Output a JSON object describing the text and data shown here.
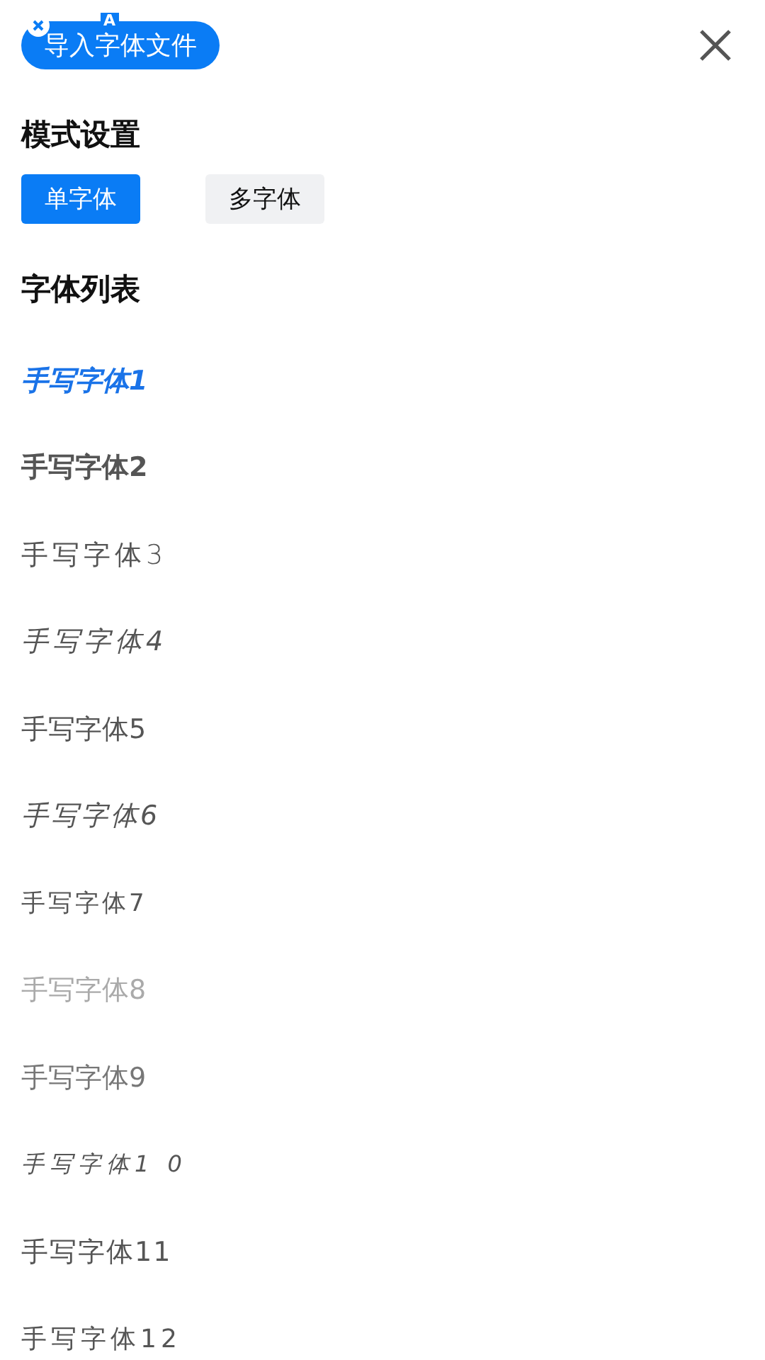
{
  "import_button": {
    "label": "导入字体文件",
    "badge_letter": "A"
  },
  "mode_section": {
    "title": "模式设置",
    "options": [
      {
        "label": "单字体",
        "selected": true
      },
      {
        "label": "多字体",
        "selected": false
      }
    ]
  },
  "font_section": {
    "title": "字体列表",
    "fonts": [
      {
        "name": "手写字体1",
        "selected": true
      },
      {
        "name": "手写字体2",
        "selected": false
      },
      {
        "name": "手写字体3",
        "selected": false
      },
      {
        "name": "手写字体4",
        "selected": false
      },
      {
        "name": "手写字体5",
        "selected": false
      },
      {
        "name": "手写字体6",
        "selected": false
      },
      {
        "name": "手写字体7",
        "selected": false
      },
      {
        "name": "手写字体8",
        "selected": false
      },
      {
        "name": "手写字体9",
        "selected": false
      },
      {
        "name": "手写字体1 0",
        "selected": false
      },
      {
        "name": "手写字体11",
        "selected": false
      },
      {
        "name": "手写字体12",
        "selected": false
      }
    ]
  }
}
